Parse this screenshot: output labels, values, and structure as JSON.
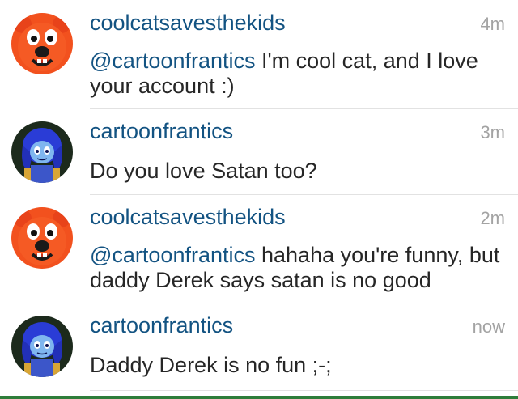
{
  "colors": {
    "username": "#135382",
    "mention": "#135382",
    "body_text": "#262626",
    "timestamp": "#a3a3a3",
    "divider": "#e2e2e2"
  },
  "comments": [
    {
      "username": "coolcatsavesthekids",
      "time": "4m",
      "mention": "@cartoonfrantics",
      "text": " I'm cool cat, and I love your account :)",
      "avatar_icon": "orange-bear-avatar-icon"
    },
    {
      "username": "cartoonfrantics",
      "time": "3m",
      "mention": "",
      "text": "Do you love Satan too?",
      "avatar_icon": "blue-cartoon-character-avatar-icon"
    },
    {
      "username": "coolcatsavesthekids",
      "time": "2m",
      "mention": "@cartoonfrantics",
      "text": " hahaha you're funny, but daddy Derek says satan is no good",
      "avatar_icon": "orange-bear-avatar-icon"
    },
    {
      "username": "cartoonfrantics",
      "time": "now",
      "mention": "",
      "text": "Daddy Derek is no fun ;-;",
      "avatar_icon": "blue-cartoon-character-avatar-icon"
    }
  ]
}
